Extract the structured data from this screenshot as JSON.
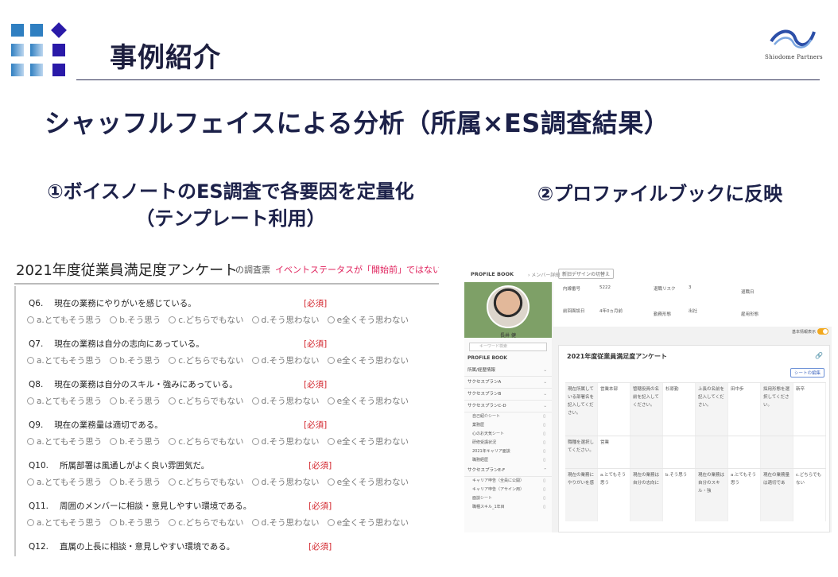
{
  "header": {
    "section_title": "事例紹介",
    "brand_name": "Shiodome Partners"
  },
  "subtitle": "シャッフルフェイスによる分析（所属×ES調査結果）",
  "columns": {
    "left_heading_line1": "①ボイスノートのES調査で各要因を定量化",
    "left_heading_line2": "（テンプレート利用）",
    "right_heading": "②プロファイルブックに反映"
  },
  "survey": {
    "title": "2021年度従業員満足度アンケート",
    "subtitle": "の調査票",
    "warning": "イベントステータスが「開始前」ではないため、",
    "required_label": "[必須]",
    "options": [
      "a.とてもそう思う",
      "b.そう思う",
      "c.どちらでもない",
      "d.そう思わない",
      "e全くそう思わない"
    ],
    "questions": [
      {
        "no": "Q6.",
        "text": "現在の業務にやりがいを感じている。"
      },
      {
        "no": "Q7.",
        "text": "現在の業務は自分の志向にあっている。"
      },
      {
        "no": "Q8.",
        "text": "現在の業務は自分のスキル・強みにあっている。"
      },
      {
        "no": "Q9.",
        "text": "現在の業務量は適切である。"
      },
      {
        "no": "Q10.",
        "text": "所属部署は風通しがよく良い雰囲気だ。"
      },
      {
        "no": "Q11.",
        "text": "周囲のメンバーに相談・意見しやすい環境である。"
      },
      {
        "no": "Q12.",
        "text": "直属の上長に相談・意見しやすい環境である。"
      }
    ]
  },
  "profile_book": {
    "logo": "PROFILE BOOK",
    "breadcrumb": "› メンバー詳細",
    "design_button": "新旧デザインの切替え",
    "person_name": "長井 健",
    "search_placeholder": "キーワード検索",
    "menu_title": "PROFILE BOOK",
    "menu": [
      "所属/経歴情報",
      "サクセスプランA",
      "サクセスプランB",
      "サクセスプランC-D"
    ],
    "submenu_a": [
      "自己紹介シート",
      "業務歴",
      "心のお天気シート",
      "研修受講状況",
      "2021年キャリア面談",
      "職務経歴"
    ],
    "menu_e": "サクセスプランE-F",
    "submenu_b": [
      "キャリア申告（全員に公開）",
      "キャリア申告（アサイン用）",
      "面談シート",
      "職種スキル_1年目"
    ],
    "info": {
      "employee_no_label": "内線番号",
      "employee_no_value": "5222",
      "retire_risk_label": "退職リスク",
      "retire_risk_value": "3",
      "retire_date_label": "退職日",
      "last_meeting_label": "前回面談日",
      "last_meeting_value": "4年0ヵ月前",
      "work_type_label": "勤務形態",
      "work_type_value": "出社",
      "employment_label": "雇用形態"
    },
    "toggle_label": "基本情報表示",
    "card_title": "2021年度従業員満足度アンケート",
    "edit_button": "シートの編集",
    "grid_row1": [
      "現在所属している部署名を記入してください。",
      "営業本部",
      "管轄役員の名前を記入してください。",
      "杉原勤",
      "上長の名前を記入してください。",
      "田中歩",
      "採用形態を選択してください。",
      "新卒"
    ],
    "grid_row2": [
      "職種を選択してください。",
      "営業",
      "",
      "",
      "",
      "",
      "",
      ""
    ],
    "grid_row3": [
      "現在の業務にやりがいを感",
      "a.とてもそう思う",
      "現在の業務は自分の志向に",
      "b.そう思う",
      "現在の業務は自分のスキル・強",
      "a.とてもそう思う",
      "現在の業務量は適切であ",
      "c.どちらでもない"
    ]
  }
}
